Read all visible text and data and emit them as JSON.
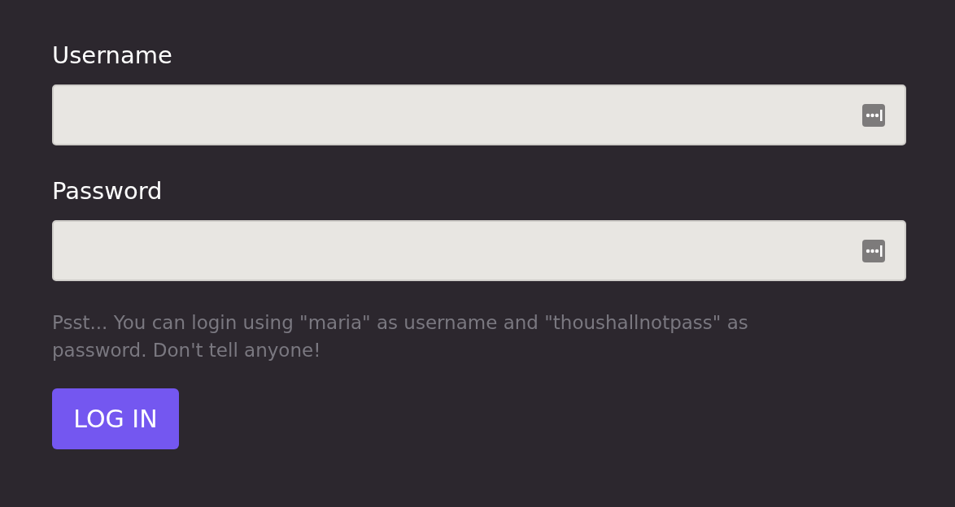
{
  "fields": [
    {
      "label": "Username"
    },
    {
      "label": "Password"
    }
  ],
  "hint": "Psst... You can login using \"maria\" as username and \"thoushallnotpass\" as password. Don't tell anyone!",
  "button": {
    "label": "LOG IN"
  }
}
